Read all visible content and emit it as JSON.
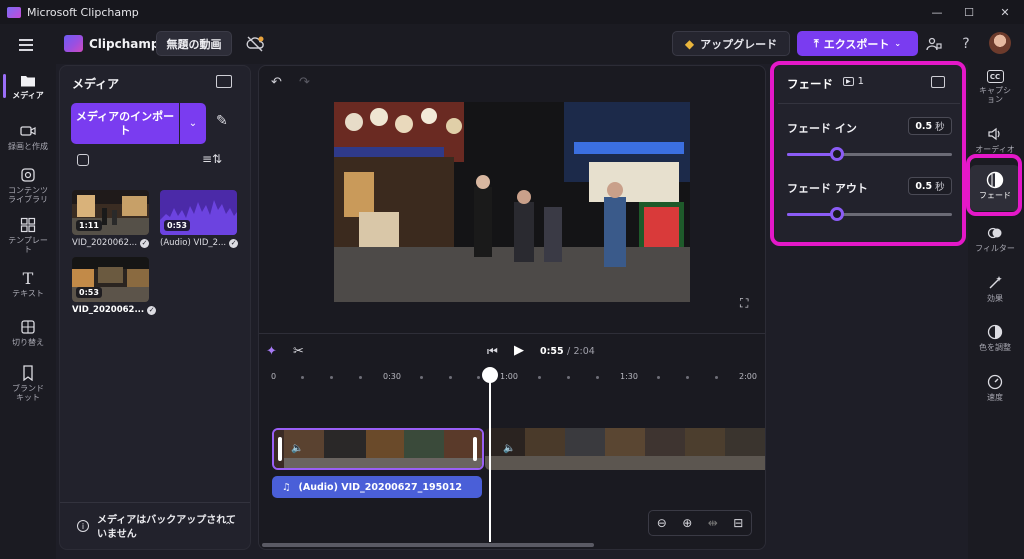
{
  "window": {
    "title": "Microsoft Clipchamp",
    "minimize": "—",
    "maximize": "☐",
    "close": "✕"
  },
  "header": {
    "logo_text": "Clipchamp",
    "project_name": "無題の動画",
    "upgrade_label": "アップグレード",
    "export_label": "エクスポート",
    "help": "?"
  },
  "leftnav": [
    {
      "label": "メディア",
      "icon": "folder-icon"
    },
    {
      "label": "録画と作成",
      "icon": "camera-icon"
    },
    {
      "label": "コンテンツライブラリ",
      "icon": "library-icon"
    },
    {
      "label": "テンプレート",
      "icon": "templates-icon"
    },
    {
      "label": "テキスト",
      "icon": "text-icon"
    },
    {
      "label": "切り替え",
      "icon": "transitions-icon"
    },
    {
      "label": "ブランドキット",
      "icon": "brand-kit-icon"
    }
  ],
  "media": {
    "title": "メディア",
    "import_label": "メディアのインポート",
    "items": [
      {
        "name": "VID_2020062...",
        "duration": "1:11"
      },
      {
        "name": "(Audio) VID_2...",
        "duration": "0:53"
      },
      {
        "name": "VID_2020062...",
        "duration": "0:53"
      }
    ],
    "backup_notice": "メディアはバックアップされていません"
  },
  "player": {
    "current_time": "0:55",
    "separator": "/",
    "total_time": "2:04"
  },
  "timeline": {
    "ticks": [
      "0",
      "0:30",
      "1:00",
      "1:30",
      "2:00"
    ],
    "audio_clip_name": "(Audio) VID_20200627_195012"
  },
  "fade": {
    "title": "フェード",
    "clip_count": "1",
    "fade_in_label": "フェード イン",
    "fade_in_value": "0.5",
    "fade_out_label": "フェード アウト",
    "fade_out_value": "0.5",
    "unit": "秒",
    "fade_in_level": 0.3,
    "fade_out_level": 0.3
  },
  "rightnav": [
    {
      "label": "キャプション",
      "icon": "captions-icon"
    },
    {
      "label": "オーディオ",
      "icon": "audio-icon"
    },
    {
      "label": "フェード",
      "icon": "fade-icon"
    },
    {
      "label": "フィルター",
      "icon": "filters-icon"
    },
    {
      "label": "効果",
      "icon": "effects-icon"
    },
    {
      "label": "色を調整",
      "icon": "color-adjust-icon"
    },
    {
      "label": "速度",
      "icon": "speed-icon"
    }
  ],
  "colors": {
    "accent": "#7a3cf0",
    "highlight": "#e418c8",
    "audio_clip": "#4a5fd8"
  }
}
